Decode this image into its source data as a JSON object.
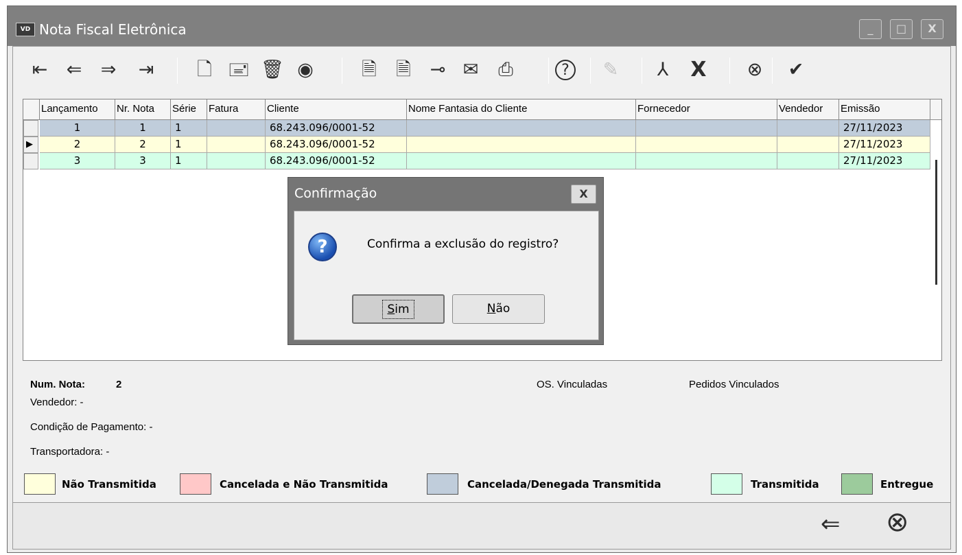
{
  "window": {
    "icon_label": "VD",
    "title": "Nota Fiscal Eletrônica",
    "minimize": "_",
    "maximize": "□",
    "close": "X"
  },
  "toolbar": [
    {
      "name": "first-record-icon",
      "glyph": "⇤"
    },
    {
      "name": "previous-record-icon",
      "glyph": "⇐"
    },
    {
      "name": "next-record-icon",
      "glyph": "⇒"
    },
    {
      "name": "last-record-icon",
      "glyph": "⇥"
    },
    {
      "name": "new-document-icon",
      "glyph": "🗋"
    },
    {
      "name": "edit-record-icon",
      "glyph": "🖃"
    },
    {
      "name": "delete-trash-icon",
      "glyph": "🗑"
    },
    {
      "name": "view-eye-icon",
      "glyph": "◉"
    },
    {
      "name": "cancel-document-icon",
      "glyph": "🗎"
    },
    {
      "name": "document-action-icon",
      "glyph": "🗎"
    },
    {
      "name": "transmit-signal-icon",
      "glyph": "⊸"
    },
    {
      "name": "email-envelope-icon",
      "glyph": "✉"
    },
    {
      "name": "print-icon",
      "glyph": "⎙"
    },
    {
      "name": "help-icon",
      "glyph": "?"
    },
    {
      "name": "edit-disabled-icon",
      "glyph": "✎"
    },
    {
      "name": "pdf-icon",
      "glyph": "⅄"
    },
    {
      "name": "xml-x-icon",
      "glyph": "X"
    },
    {
      "name": "cancel-circle-icon",
      "glyph": "⊗"
    },
    {
      "name": "confirm-check-icon",
      "glyph": "✔"
    }
  ],
  "grid": {
    "columns": [
      "Lançamento",
      "Nr. Nota",
      "Série",
      "Fatura",
      "Cliente",
      "Nome Fantasia do Cliente",
      "Fornecedor",
      "Vendedor",
      "Emissão"
    ],
    "rows": [
      {
        "lancamento": "1",
        "nr_nota": "1",
        "serie": "1",
        "fatura": "",
        "cliente": "68.243.096/0001-52",
        "nome_fantasia": "",
        "fornecedor": "",
        "vendedor": "",
        "emissao": "27/11/2023"
      },
      {
        "lancamento": "2",
        "nr_nota": "2",
        "serie": "1",
        "fatura": "",
        "cliente": "68.243.096/0001-52",
        "nome_fantasia": "",
        "fornecedor": "",
        "vendedor": "",
        "emissao": "27/11/2023"
      },
      {
        "lancamento": "3",
        "nr_nota": "3",
        "serie": "1",
        "fatura": "",
        "cliente": "68.243.096/0001-52",
        "nome_fantasia": "",
        "fornecedor": "",
        "vendedor": "",
        "emissao": "27/11/2023"
      }
    ],
    "row_colors": [
      "#c0cddb",
      "#ffffdc",
      "#d4ffe8"
    ],
    "current_row_marker": "▶"
  },
  "info": {
    "num_nota_label": "Num. Nota:",
    "num_nota_value": "2",
    "vendedor": "Vendedor: -",
    "condicao": "Condição de Pagamento: -",
    "transportadora": "Transportadora: -",
    "os_vinculadas": "OS. Vinculadas",
    "pedidos_vinculados": "Pedidos Vinculados"
  },
  "legend": [
    {
      "label": "Não Transmitida",
      "color": "#ffffdc"
    },
    {
      "label": "Cancelada e Não Transmitida",
      "color": "#ffc8c8"
    },
    {
      "label": "Cancelada/Denegada Transmitida",
      "color": "#c0cddb"
    },
    {
      "label": "Transmitida",
      "color": "#d4ffe8"
    },
    {
      "label": "Entregue",
      "color": "#9ccb9c"
    }
  ],
  "bottom": {
    "back_icon": "⇐",
    "close_icon": "⊗"
  },
  "dialog": {
    "title": "Confirmação",
    "close": "X",
    "icon": "?",
    "message": "Confirma a exclusão do registro?",
    "yes_hotkey": "S",
    "yes_rest": "im",
    "no_hotkey": "N",
    "no_rest": "ão"
  }
}
